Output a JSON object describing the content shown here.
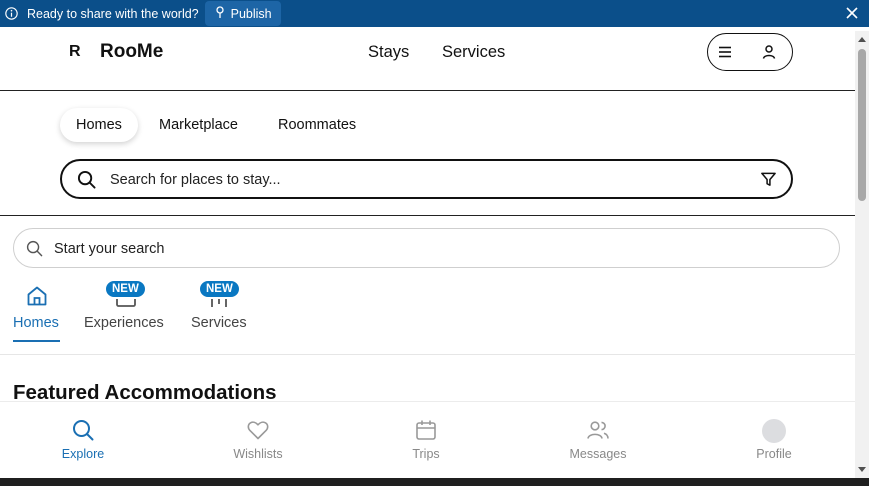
{
  "banner": {
    "message": "Ready to share with the world?",
    "publish_label": "Publish",
    "bg_color": "#0b4f8a"
  },
  "header": {
    "logo_mark": "R",
    "logo_text": "RooMe",
    "nav": [
      "Stays",
      "Services"
    ]
  },
  "segments": {
    "items": [
      "Homes",
      "Marketplace",
      "Roommates"
    ],
    "active": "Homes"
  },
  "main_search": {
    "placeholder": "Search for places to stay..."
  },
  "start_search": {
    "placeholder": "Start your search"
  },
  "category_tabs": {
    "items": [
      {
        "label": "Homes",
        "badge": "",
        "icon": "home-icon"
      },
      {
        "label": "Experiences",
        "badge": "NEW",
        "icon": "experiences-icon"
      },
      {
        "label": "Services",
        "badge": "NEW",
        "icon": "services-icon"
      }
    ],
    "active": "Homes",
    "accent_color": "#1a6fb3"
  },
  "section": {
    "title": "Featured Accommodations"
  },
  "bottom_nav": {
    "items": [
      {
        "label": "Explore",
        "icon": "search-icon"
      },
      {
        "label": "Wishlists",
        "icon": "heart-icon"
      },
      {
        "label": "Trips",
        "icon": "calendar-icon"
      },
      {
        "label": "Messages",
        "icon": "users-icon"
      },
      {
        "label": "Profile",
        "icon": "avatar"
      }
    ],
    "active": "Explore"
  }
}
